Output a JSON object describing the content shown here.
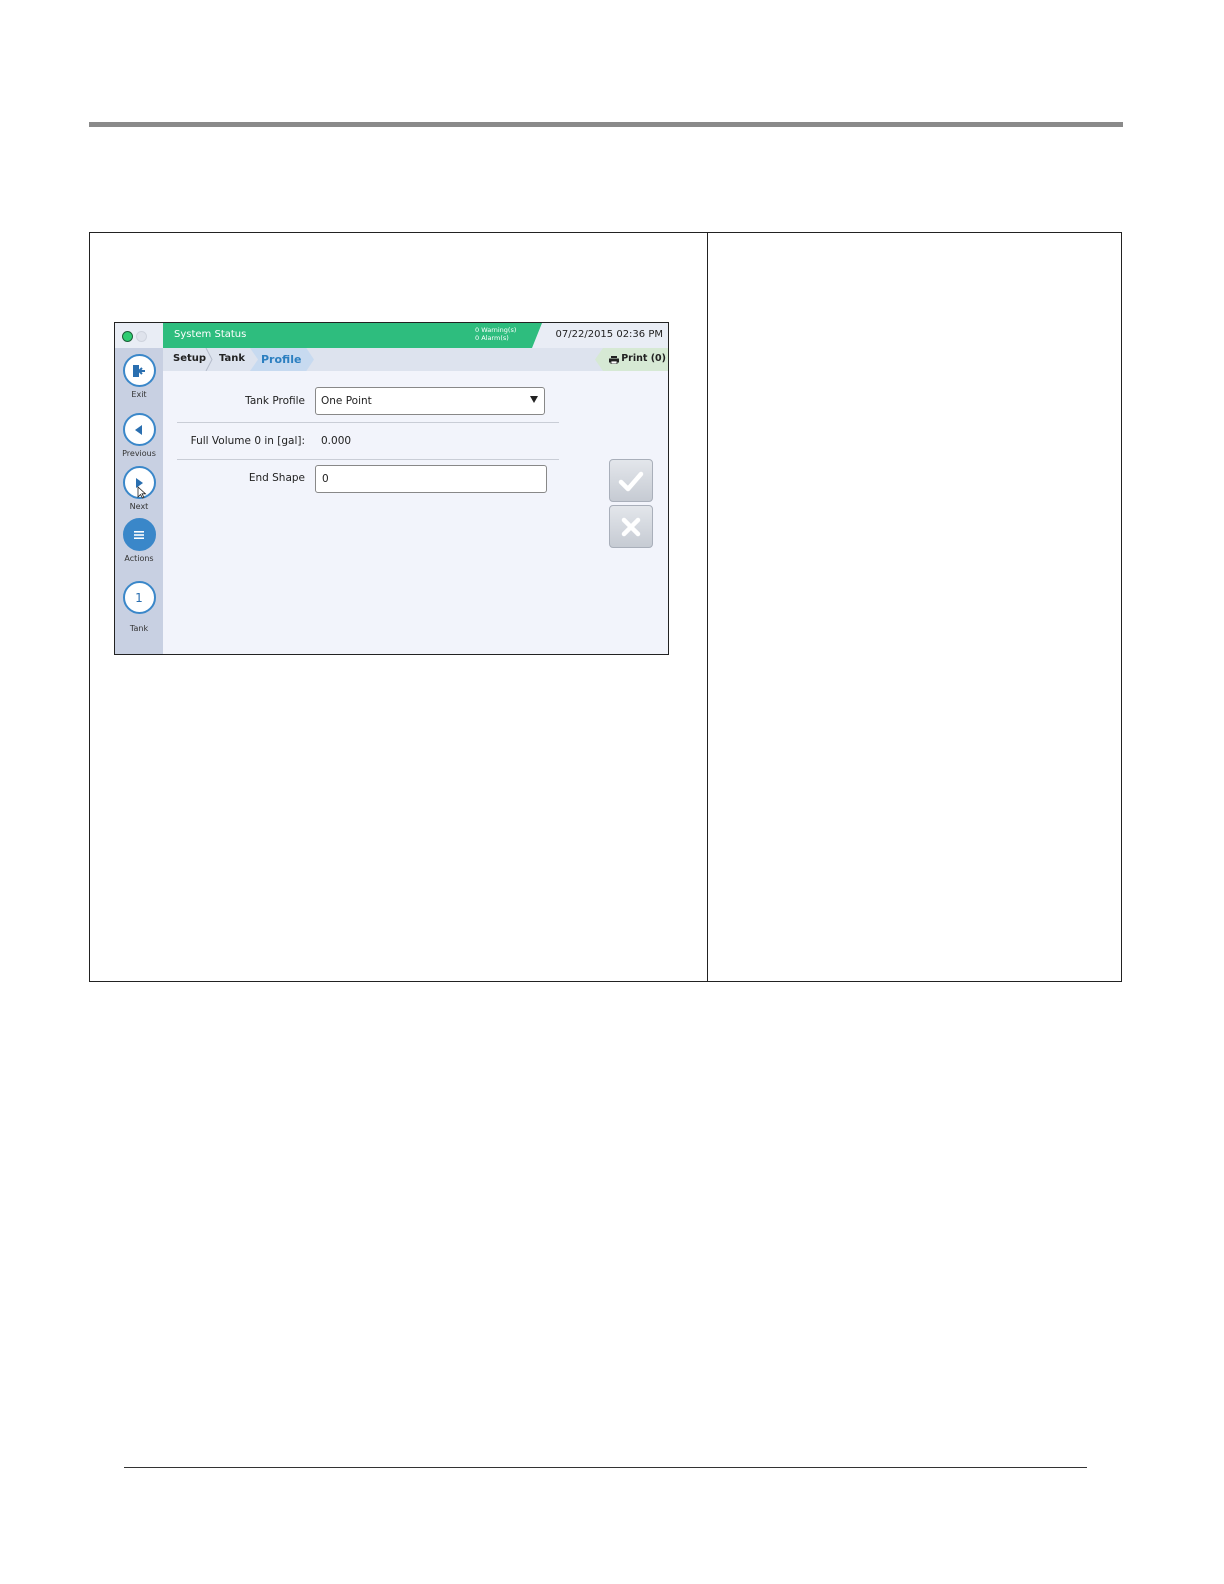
{
  "screen": {
    "status_title": "System Status",
    "warnings": "0 Warning(s)",
    "alarms": "0 Alarm(s)",
    "datetime": "07/22/2015 02:36 PM",
    "sidebar": {
      "exit": "Exit",
      "previous": "Previous",
      "next": "Next",
      "actions": "Actions",
      "tank_number": "1",
      "tank": "Tank"
    },
    "breadcrumb": {
      "setup": "Setup",
      "tank": "Tank",
      "profile": "Profile"
    },
    "print_label": "Print (0)",
    "form": {
      "tank_profile_label": "Tank Profile",
      "tank_profile_value": "One Point",
      "full_volume_label": "Full Volume 0 in [gal]:",
      "full_volume_value": "0.000",
      "end_shape_label": "End Shape",
      "end_shape_value": "0"
    }
  },
  "colors": {
    "title_bar": "#2ebd7e",
    "accent_blue": "#3a87c9",
    "sidebar": "#c8d0e2"
  }
}
